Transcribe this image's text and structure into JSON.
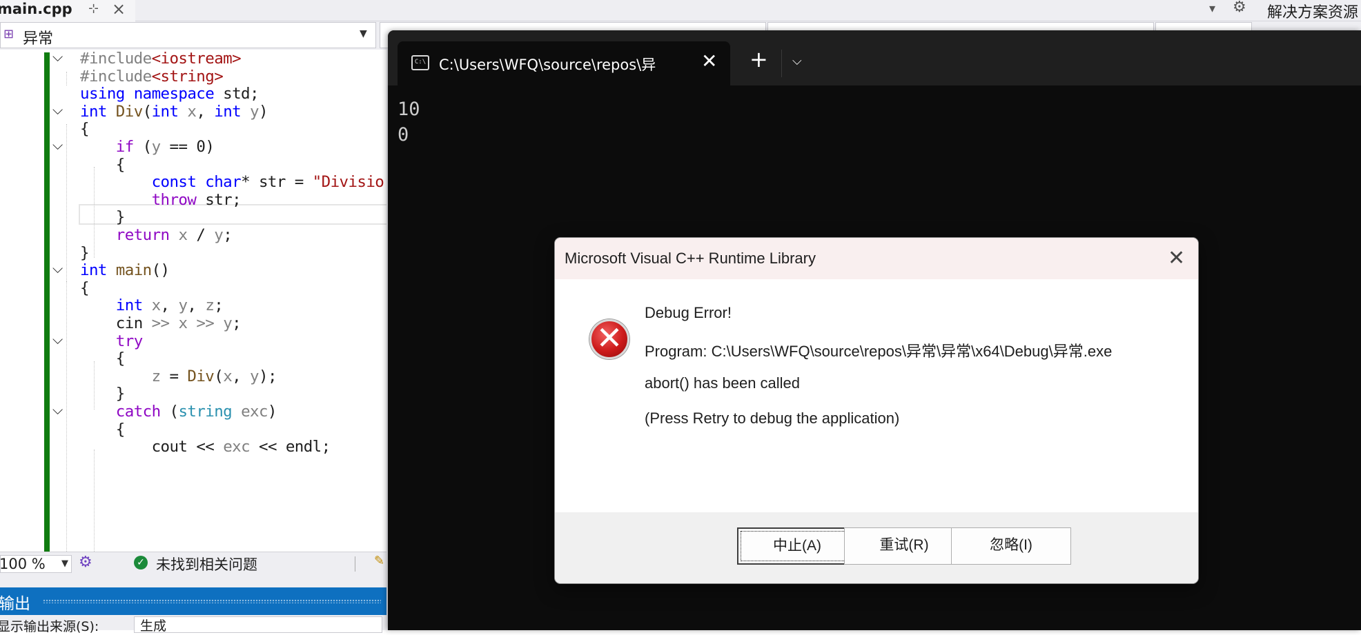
{
  "vs": {
    "doc_tab_title": "main.cpp",
    "pin_glyph": "⊹",
    "close_glyph": "×",
    "solution_explorer_title": "解决方案资源",
    "scope": "异常",
    "zoom": "100 %",
    "issues": "未找到相关问题",
    "output_title": "输出",
    "output_source_label": "显示输出来源(S):",
    "output_source_value": "生成"
  },
  "code_lines": [
    "#include<iostream>",
    "#include<string>",
    "using namespace std;",
    "int Div(int x, int y)",
    "{",
    "    if (y == 0)",
    "    {",
    "        const char* str = \"Divisio",
    "        throw str;",
    "    }",
    "    return x / y;",
    "}",
    "int main()",
    "{",
    "    int x, y, z;",
    "    cin >> x >> y;",
    "    try",
    "    {",
    "        z = Div(x, y);",
    "    }",
    "    catch (string exc)",
    "    {",
    "        cout << exc << endl;"
  ],
  "terminal": {
    "tab_title": "C:\\Users\\WFQ\\source\\repos\\异",
    "icon_text": "C:\\",
    "output": [
      "10",
      "0"
    ]
  },
  "dialog": {
    "title": "Microsoft Visual C++ Runtime Library",
    "heading": "Debug Error!",
    "program": "Program: C:\\Users\\WFQ\\source\\repos\\异常\\异常\\x64\\Debug\\异常.exe",
    "message": "abort() has been called",
    "hint": "(Press Retry to debug the application)",
    "buttons": {
      "abort": "中止(A)",
      "retry": "重试(R)",
      "ignore": "忽略(I)"
    }
  },
  "colors": {
    "keyword": "#0000ff",
    "control_keyword": "#8f08c4",
    "preprocessor": "#808080",
    "string": "#a31515",
    "function": "#74531f",
    "parameter": "#808080",
    "type": "#2b91af",
    "change_bar": "#107c10",
    "output_header": "#0e70c0",
    "dialog_title_bg": "#f9efef",
    "error_red": "#cc1a1a"
  }
}
